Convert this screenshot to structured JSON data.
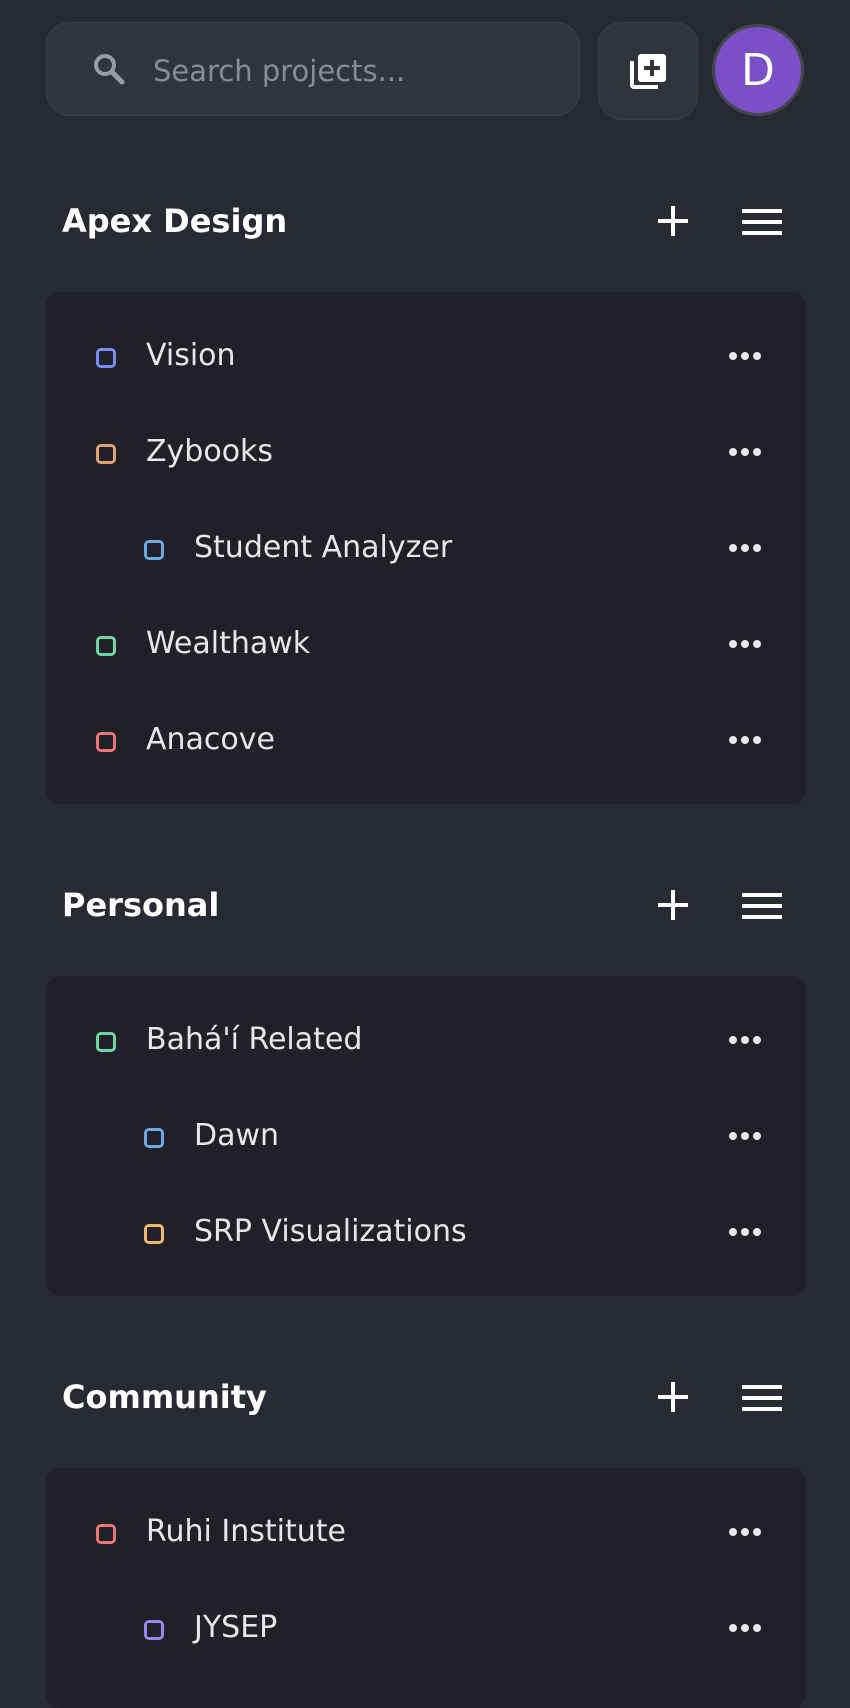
{
  "search": {
    "placeholder": "Search projects..."
  },
  "user": {
    "avatar_initial": "D"
  },
  "groups": [
    {
      "title": "Apex Design",
      "projects": [
        {
          "label": "Vision",
          "color": "#7b8cf5"
        },
        {
          "label": "Zybooks",
          "color": "#e0a070"
        },
        {
          "label": "Student Analyzer",
          "color": "#6fa6e6"
        },
        {
          "label": "Wealthawk",
          "color": "#6fd6a0"
        },
        {
          "label": "Anacove",
          "color": "#f07575"
        }
      ]
    },
    {
      "title": "Personal",
      "projects": [
        {
          "label": "Bahá'í Related",
          "color": "#6fd6a0"
        },
        {
          "label": "Dawn",
          "color": "#6fa6e6"
        },
        {
          "label": "SRP Visualizations",
          "color": "#f0b86a"
        }
      ]
    },
    {
      "title": "Community",
      "projects": [
        {
          "label": "Ruhi Institute",
          "color": "#f07575"
        },
        {
          "label": "JYSEP",
          "color": "#9a86ec"
        }
      ]
    }
  ]
}
